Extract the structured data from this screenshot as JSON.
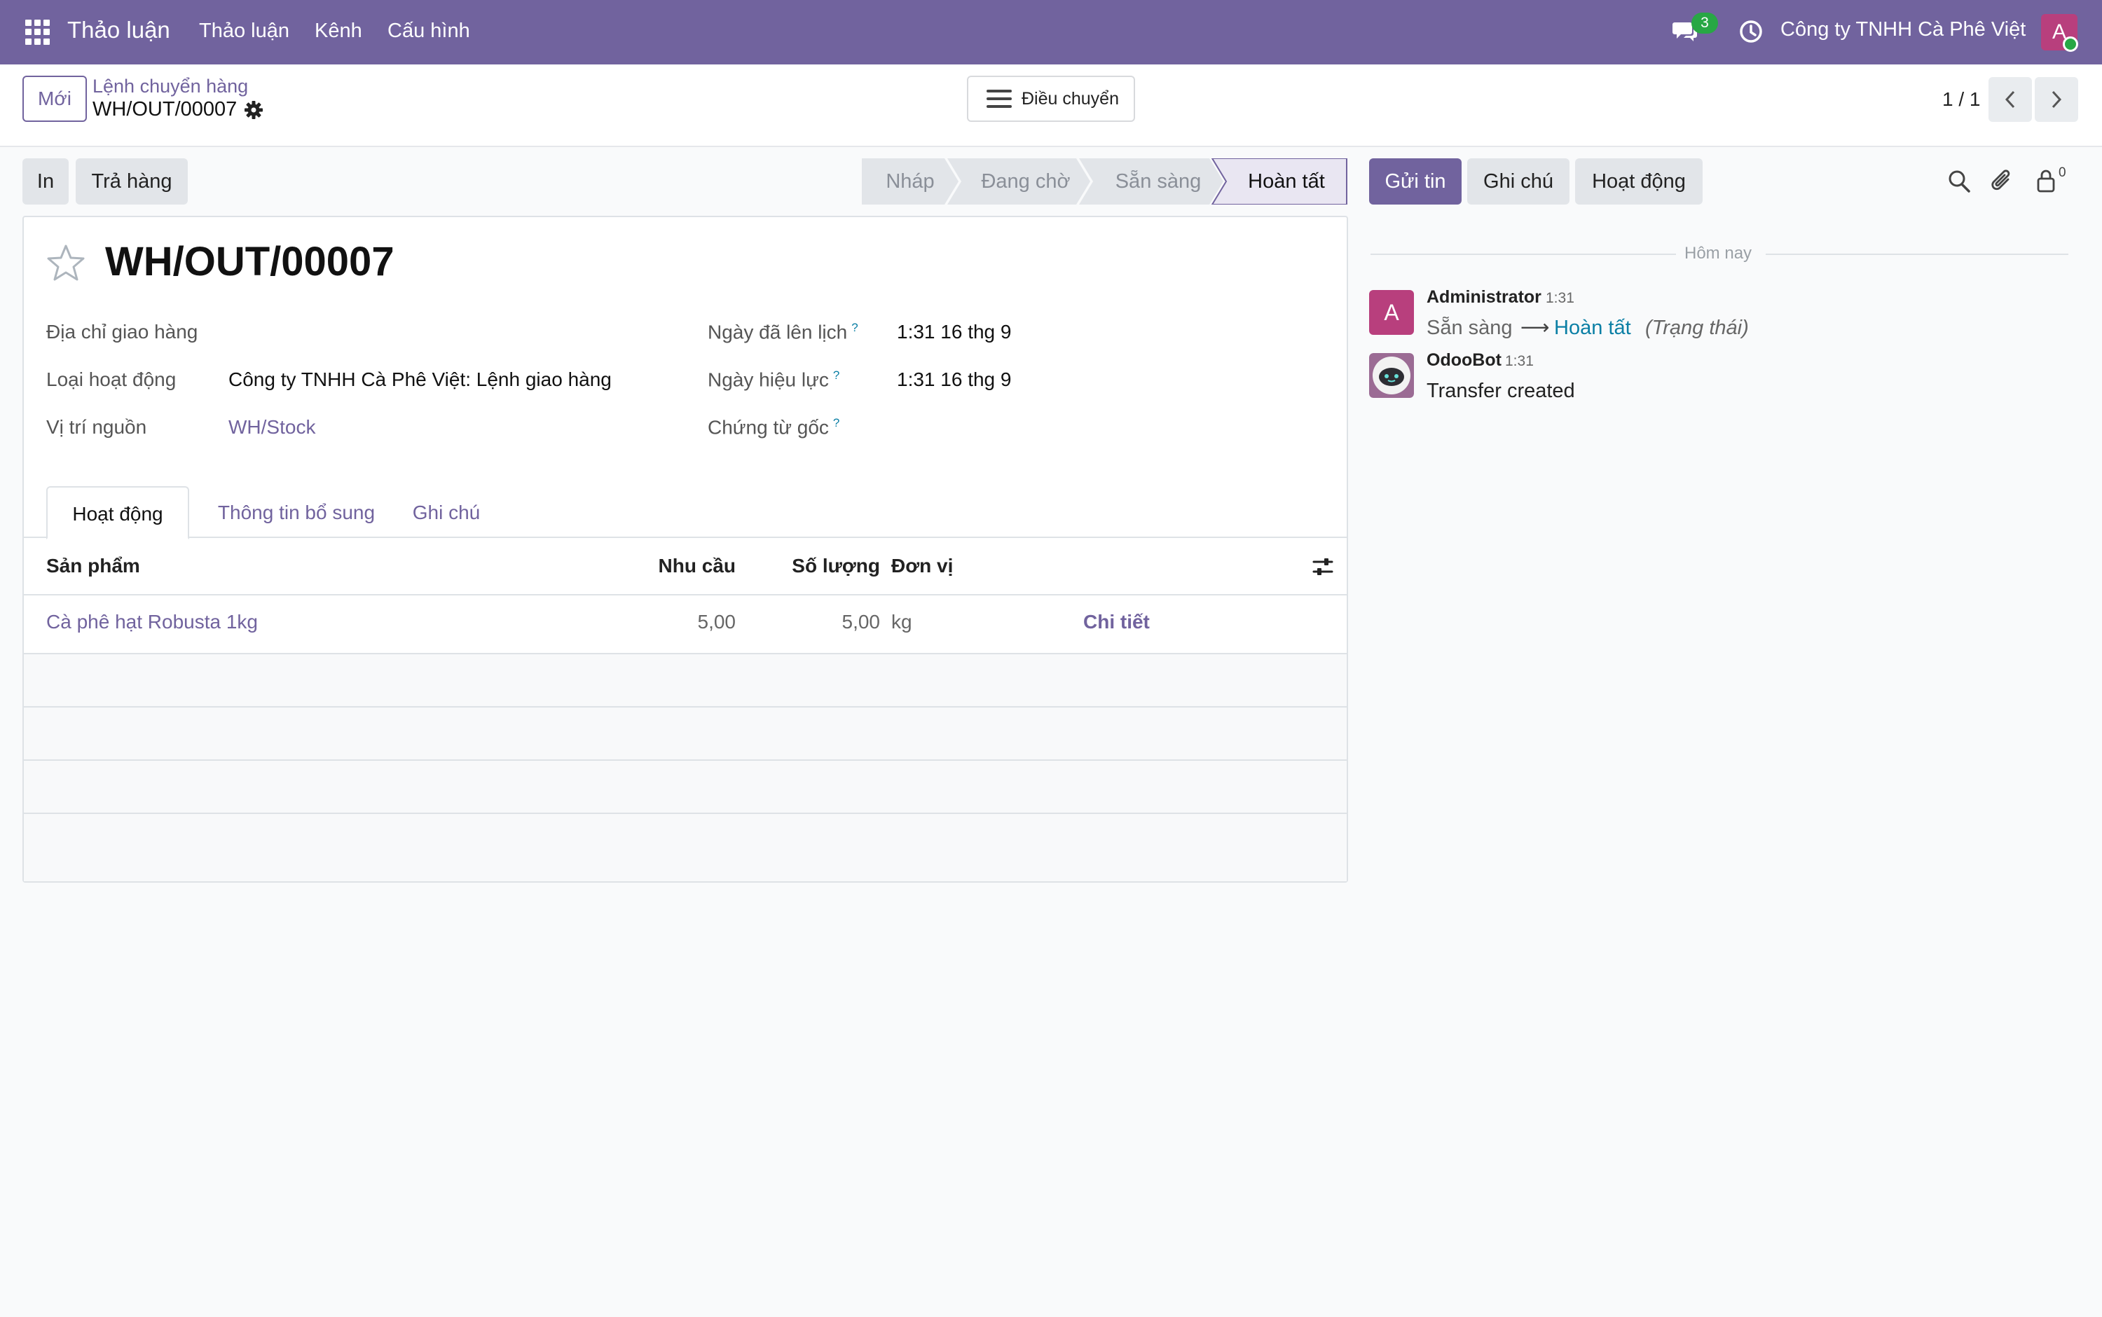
{
  "navbar": {
    "brand": "Thảo luận",
    "menu": [
      "Thảo luận",
      "Kênh",
      "Cấu hình"
    ],
    "message_count": "3",
    "company": "Công ty TNHH Cà Phê Việt",
    "user_initial": "A",
    "accent": "#71639e"
  },
  "control": {
    "new_label": "Mới",
    "breadcrumb_parent": "Lệnh chuyển hàng",
    "breadcrumb_current": "WH/OUT/00007",
    "transfer_label": "Điều chuyển",
    "pager": "1 / 1"
  },
  "actions": {
    "print": "In",
    "return": "Trả hàng"
  },
  "statusbar": {
    "stages": [
      "Nháp",
      "Đang chờ",
      "Sẵn sàng",
      "Hoàn tất"
    ],
    "current": "Hoàn tất"
  },
  "form": {
    "title": "WH/OUT/00007",
    "delivery_address_label": "Địa chỉ giao hàng",
    "operation_type_label": "Loại hoạt động",
    "operation_type_value": "Công ty TNHH Cà Phê Việt: Lệnh giao hàng",
    "source_location_label": "Vị trí nguồn",
    "source_location_value": "WH/Stock",
    "scheduled_date_label": "Ngày đã lên lịch",
    "scheduled_date_value": "1:31 16 thg 9",
    "effective_date_label": "Ngày hiệu lực",
    "effective_date_value": "1:31 16 thg 9",
    "origin_label": "Chứng từ gốc",
    "help_mark": "?"
  },
  "tabs": [
    "Hoạt động",
    "Thông tin bổ sung",
    "Ghi chú"
  ],
  "table": {
    "headers": {
      "product": "Sản phẩm",
      "demand": "Nhu cầu",
      "quantity": "Số lượng",
      "uom": "Đơn vị"
    },
    "rows": [
      {
        "product": "Cà phê hạt Robusta 1kg",
        "demand": "5,00",
        "quantity": "5,00",
        "uom": "kg",
        "details": "Chi tiết"
      }
    ]
  },
  "chatter": {
    "send_message": "Gửi tin",
    "log_note": "Ghi chú",
    "activity": "Hoạt động",
    "follower_count": "0",
    "today": "Hôm nay",
    "messages": [
      {
        "author": "Administrator",
        "initial": "A",
        "time": "1:31",
        "old_value": "Sẵn sàng",
        "arrow": "⟶",
        "new_value": "Hoàn tất",
        "field": "(Trạng thái)"
      },
      {
        "author": "OdooBot",
        "time": "1:31",
        "body": "Transfer created"
      }
    ]
  }
}
